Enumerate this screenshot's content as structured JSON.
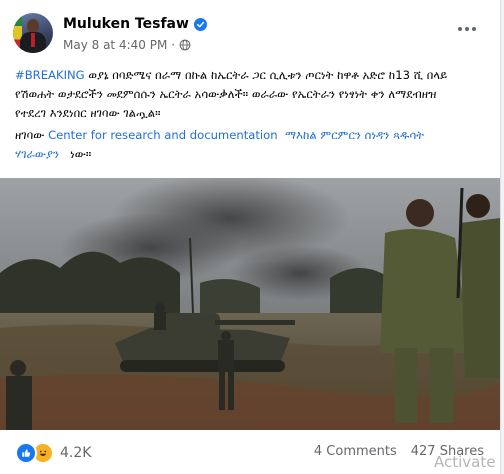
{
  "post": {
    "author": "Muluken Tesfaw",
    "timestamp": "May 8 at 4:40 PM",
    "body_lines": [
      {
        "hashtag": "#BREAKING",
        "text": " ወያኔ በባድሜና በራማ በኩል ከኤርትራ ጋር ሲሊቱን ጦርነት ከዋቶ አድሮ ከ13 ሺ በላይ"
      },
      {
        "text": "የሽወሐት ወታደሮችን መደምሰሱን ኤርትራ አሳውቃለች። ወራራው የኤርትራን የነፃነት ቀን ለማደብዘዝ"
      },
      {
        "text": "የተደረገ እንደነበር ዘገባው ገልጧል።"
      }
    ],
    "source_prefix": "ዘገባው",
    "source_link": "Center for research and documentation",
    "source_amharic": "ማእከል ምርምርን ሰነዳን ጻዱሳት",
    "source_line2_link": "ሃገራውያን",
    "source_suffix": "ነው።",
    "reaction_count": "4.2K",
    "comments": "4 Comments",
    "shares": "427 Shares"
  },
  "overlay": {
    "watermark": "Activate"
  },
  "icons": {
    "verified": "verified-badge-icon",
    "globe": "globe-icon",
    "more": "more-options-icon",
    "like": "like-reaction-icon",
    "haha": "haha-reaction-icon"
  },
  "colors": {
    "link": "#216fdb",
    "meta": "#65676b",
    "verified": "#1877f2"
  }
}
